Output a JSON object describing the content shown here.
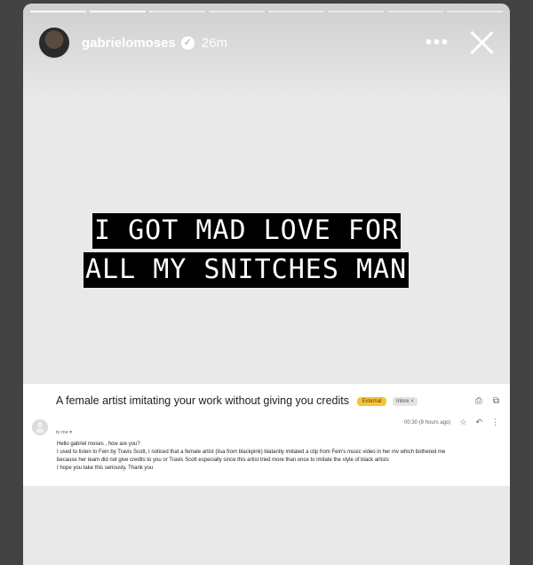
{
  "story": {
    "progress": [
      1,
      1,
      0.03,
      0,
      0,
      0,
      0,
      0
    ],
    "username": "gabrielomoses",
    "time": "26m",
    "more_label": "•••",
    "verified_glyph": "✓",
    "icons": {
      "verified": "verified-badge-icon",
      "more": "more-options-icon",
      "close": "close-icon"
    }
  },
  "caption": {
    "line1": "I GOT MAD LOVE FOR",
    "line2": "ALL MY SNITCHES MAN"
  },
  "email": {
    "subject": "A female artist imitating your work without giving you credits",
    "tag_external": "External",
    "tag_inbox": "Inbox ×",
    "icons": {
      "print": "print-icon",
      "open_new": "open-in-new-icon",
      "star": "star-icon",
      "reply": "reply-icon",
      "more": "more-vert-icon"
    },
    "timestamp": "00:30 (9 hours ago)",
    "to": "to me ▾",
    "body": [
      "Hello gabriel moses , how are you?",
      "I used to listen to Fein by Travis Scott, I noticed that a female artist (lisa from blackpink) blatantly imitated a clip from Fein's music video in her mv which bothered me",
      "because her team did not give credits to you or Travis Scott especially since this artist tried more than once to imitate the style of black artists",
      "I hope you take this seriously. Thank you"
    ]
  }
}
